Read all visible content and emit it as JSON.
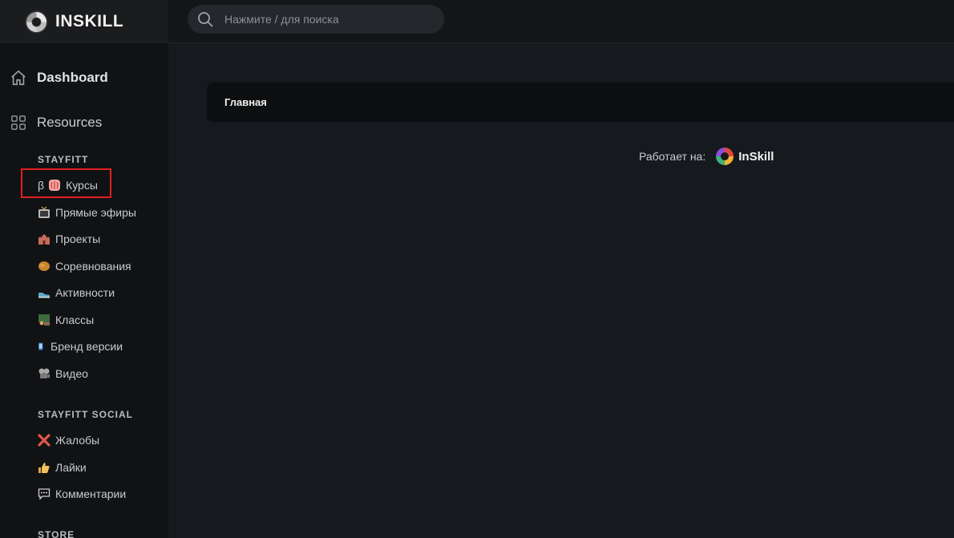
{
  "brand": {
    "name": "INSKILL"
  },
  "search": {
    "placeholder": "Нажмите / для поиска"
  },
  "nav": {
    "dashboard": "Dashboard",
    "resources": "Resources"
  },
  "sections": {
    "stayfitt": {
      "title": "STAYFITT",
      "items": [
        {
          "prefix": "β",
          "label": "Курсы",
          "icon": "brain-icon"
        },
        {
          "label": "Прямые эфиры",
          "icon": "tv-icon"
        },
        {
          "label": "Проекты",
          "icon": "castle-icon"
        },
        {
          "label": "Соревнования",
          "icon": "glove-icon"
        },
        {
          "label": "Активности",
          "icon": "sneaker-icon"
        },
        {
          "label": "Классы",
          "icon": "class-icon"
        },
        {
          "label": "Бренд версии",
          "icon": "phone-icon"
        },
        {
          "label": "Видео",
          "icon": "film-reel-icon"
        }
      ]
    },
    "social": {
      "title": "STAYFITT SOCIAL",
      "items": [
        {
          "label": "Жалобы",
          "icon": "cross-icon"
        },
        {
          "label": "Лайки",
          "icon": "thumbs-up-icon"
        },
        {
          "label": "Комментарии",
          "icon": "speech-bubble-icon"
        }
      ]
    },
    "store": {
      "title": "STORE"
    }
  },
  "main": {
    "card_title": "Главная",
    "powered_label": "Работает на:",
    "powered_name": "InSkill"
  },
  "colors": {
    "highlight": "#e01f1f",
    "sidebar_bg": "#111214",
    "main_bg": "#16191d"
  }
}
